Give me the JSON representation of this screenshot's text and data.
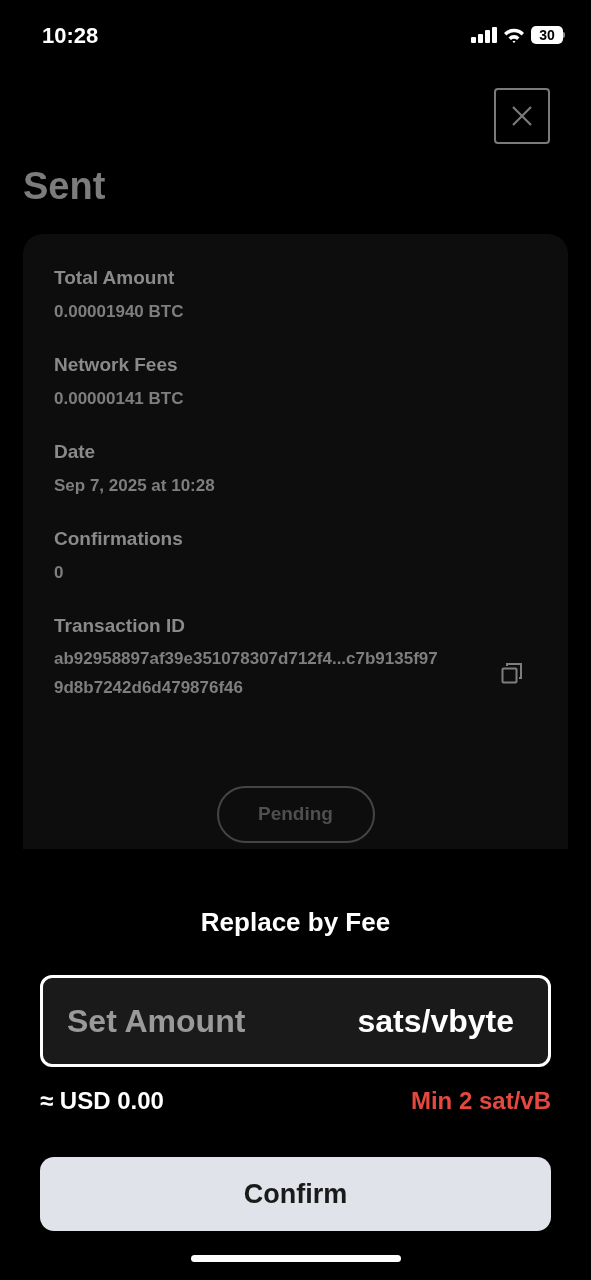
{
  "status_bar": {
    "time": "10:28",
    "battery": "30"
  },
  "title": "Sent",
  "details": [
    {
      "label": "Total Amount",
      "value": "0.00001940 BTC"
    },
    {
      "label": "Network Fees",
      "value": "0.00000141 BTC"
    },
    {
      "label": "Date",
      "value": "Sep 7, 2025 at 10:28"
    },
    {
      "label": "Confirmations",
      "value": "0"
    }
  ],
  "transaction_id": {
    "label": "Transaction ID",
    "value": "ab92958897af39e351078307d712f4...c7b9135f97 9d8b7242d6d479876f46"
  },
  "status": "Pending",
  "sheet": {
    "title": "Replace by Fee",
    "field": {
      "placeholder": "Set Amount",
      "unit": "sats/vbyte"
    },
    "fiat": "≈ USD 0.00",
    "minimum": "Min 2 sat/vB",
    "confirm": "Confirm"
  }
}
